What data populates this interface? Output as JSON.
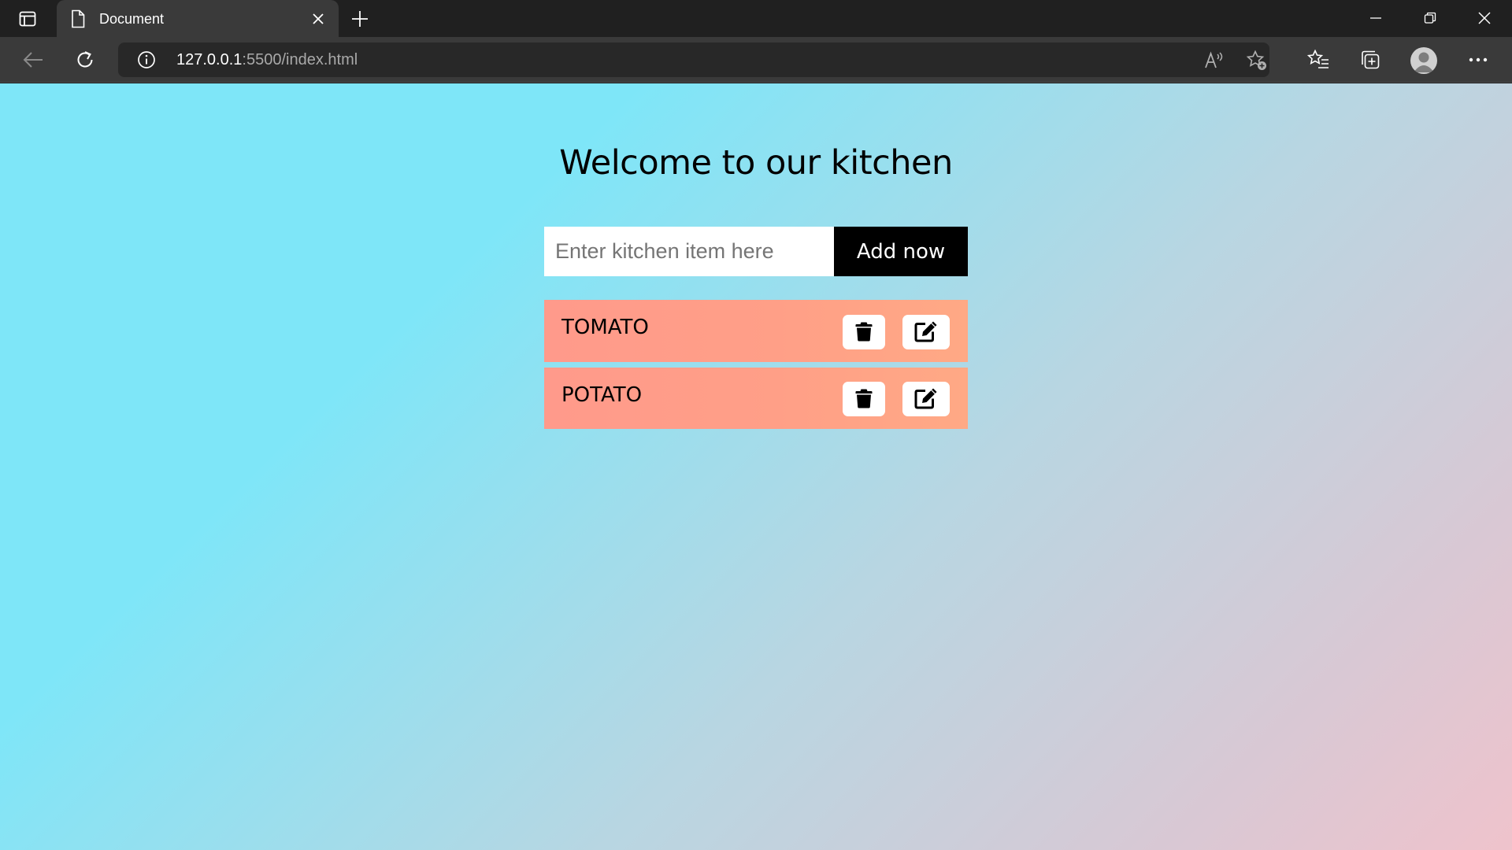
{
  "browser": {
    "tab_title": "Document",
    "url_host": "127.0.0.1",
    "url_path": ":5500/index.html"
  },
  "page": {
    "title": "Welcome to our kitchen",
    "input_placeholder": "Enter kitchen item here",
    "input_value": "",
    "add_button_label": "Add now",
    "items": [
      {
        "name": "TOMATO"
      },
      {
        "name": "POTATO"
      }
    ],
    "colors": {
      "background_start": "#7ee6f8",
      "background_end": "#efc3cc",
      "item_start": "#ff9a8b",
      "item_end": "#ffa985",
      "add_button": "#000000"
    }
  },
  "icons": {
    "delete": "trash-icon",
    "edit": "edit-icon"
  }
}
